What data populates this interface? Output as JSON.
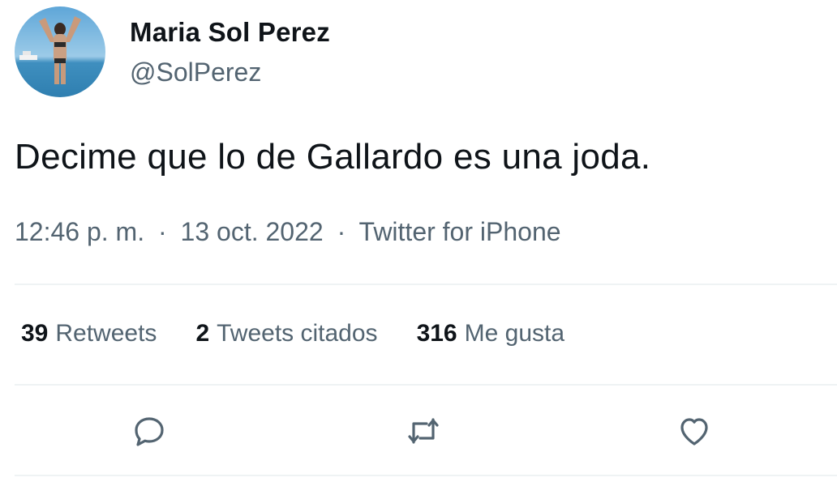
{
  "user": {
    "display_name": "Maria Sol Perez",
    "handle": "@SolPerez"
  },
  "tweet": {
    "text": "Decime que lo de Gallardo es una joda.",
    "time": "12:46 p. m.",
    "date": "13 oct. 2022",
    "separator": "·",
    "source": "Twitter for iPhone"
  },
  "stats": [
    {
      "count": "39",
      "label": "Retweets"
    },
    {
      "count": "2",
      "label": "Tweets citados"
    },
    {
      "count": "316",
      "label": "Me gusta"
    }
  ],
  "actions": {
    "reply_icon": "reply-icon",
    "retweet_icon": "retweet-icon",
    "like_icon": "heart-icon"
  },
  "colors": {
    "text_primary": "#0f1419",
    "text_secondary": "#536471",
    "divider": "#eff3f4"
  }
}
